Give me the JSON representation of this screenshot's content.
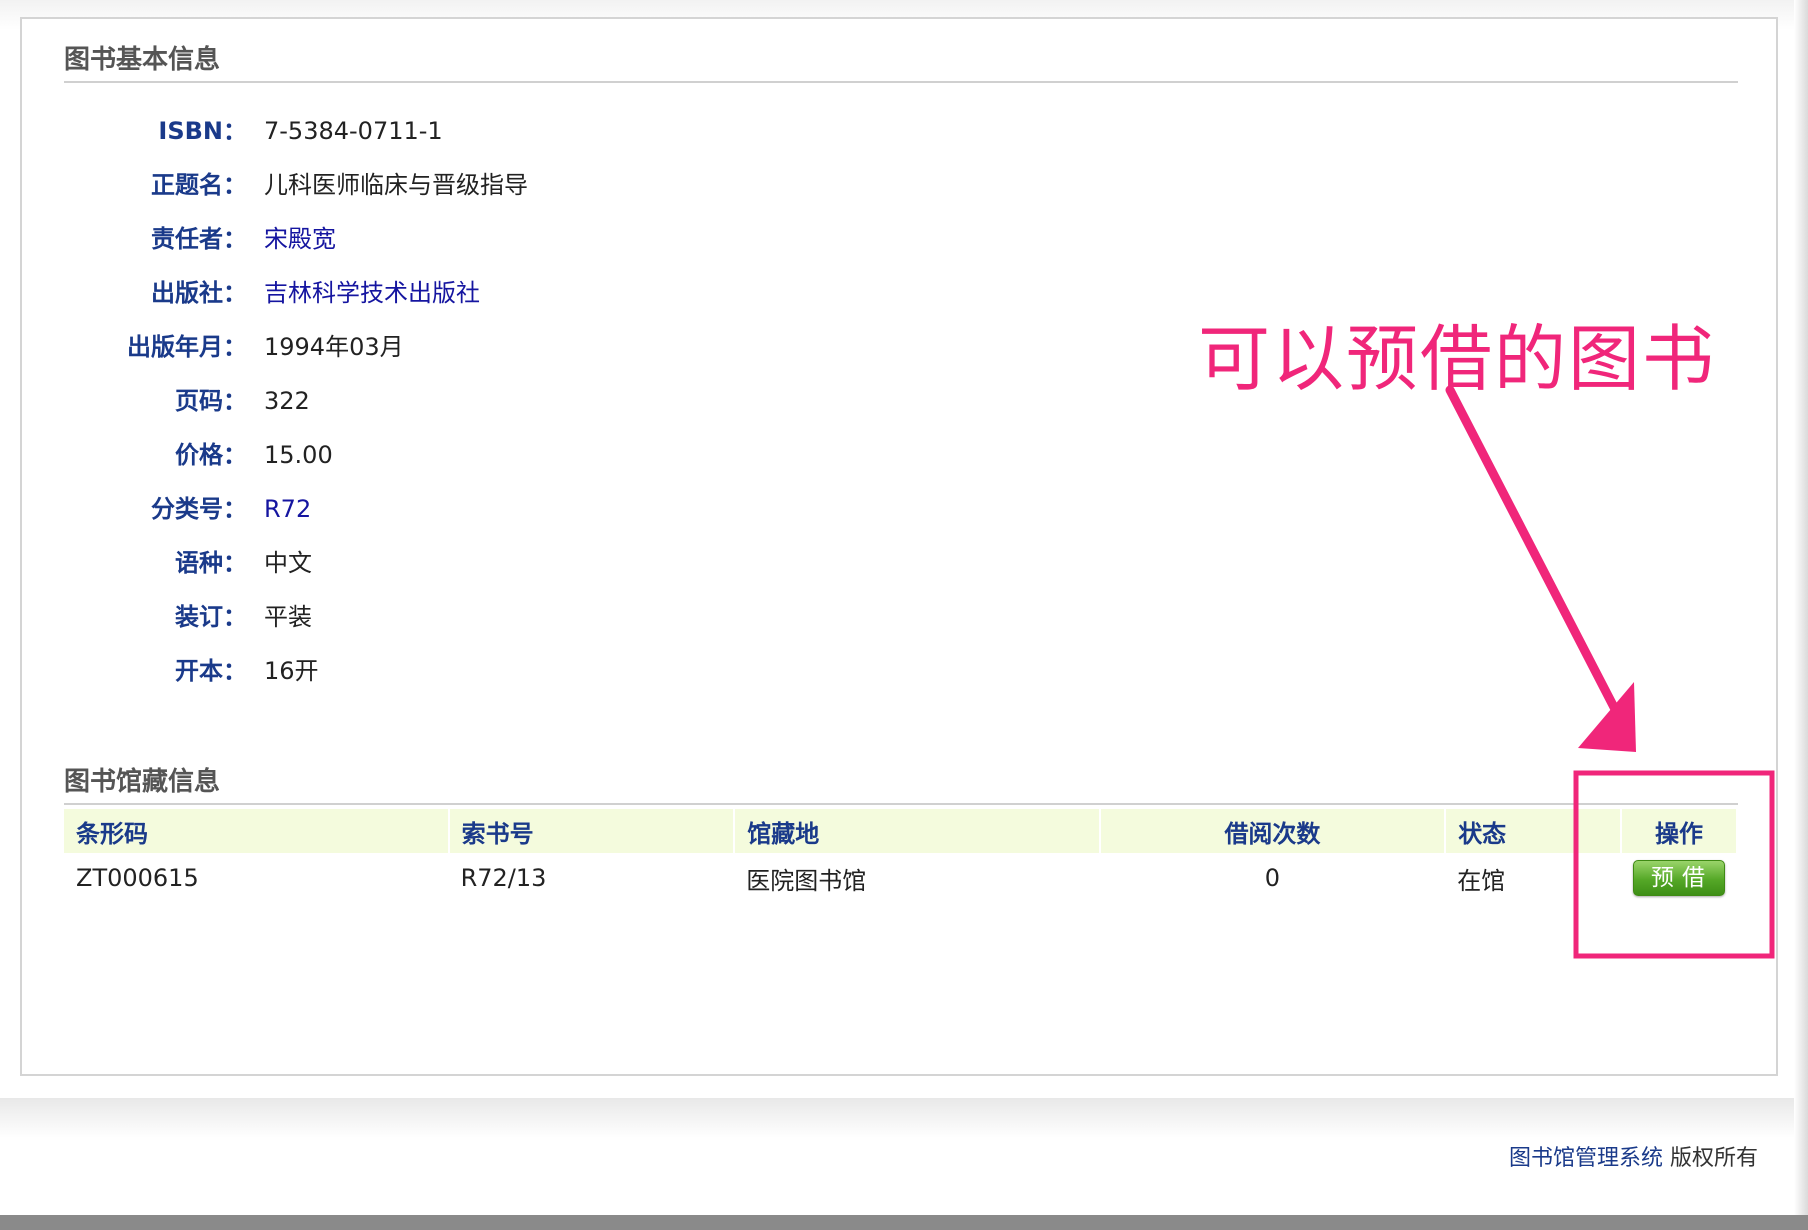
{
  "basic_info": {
    "title": "图书基本信息",
    "fields": [
      {
        "label": "ISBN：",
        "value": "7-5384-0711-1"
      },
      {
        "label": "正题名：",
        "value": "儿科医师临床与晋级指导"
      },
      {
        "label": "责任者：",
        "value": "宋殿宽"
      },
      {
        "label": "出版社：",
        "value": "吉林科学技术出版社"
      },
      {
        "label": "出版年月：",
        "value": "1994年03月"
      },
      {
        "label": "页码：",
        "value": "322"
      },
      {
        "label": "价格：",
        "value": "15.00"
      },
      {
        "label": "分类号：",
        "value": "R72"
      },
      {
        "label": "语种：",
        "value": "中文"
      },
      {
        "label": "装订：",
        "value": "平装"
      },
      {
        "label": "开本：",
        "value": "16开"
      }
    ]
  },
  "holdings": {
    "title": "图书馆藏信息",
    "columns": [
      "条形码",
      "索书号",
      "馆藏地",
      "借阅次数",
      "状态",
      "操作"
    ],
    "rows": [
      {
        "barcode": "ZT000615",
        "call_number": "R72/13",
        "location": "医院图书馆",
        "borrow_count": "0",
        "status": "在馆",
        "action": "预借"
      }
    ]
  },
  "annotation": {
    "text": "可以预借的图书",
    "color": "#f0267a"
  },
  "footer": {
    "system": "图书馆管理系统",
    "rights": " 版权所有"
  },
  "colors": {
    "label": "#1a3a8a",
    "link": "#1515a0",
    "header_bg": "#f4fbdd",
    "button_green": "#55a827"
  }
}
